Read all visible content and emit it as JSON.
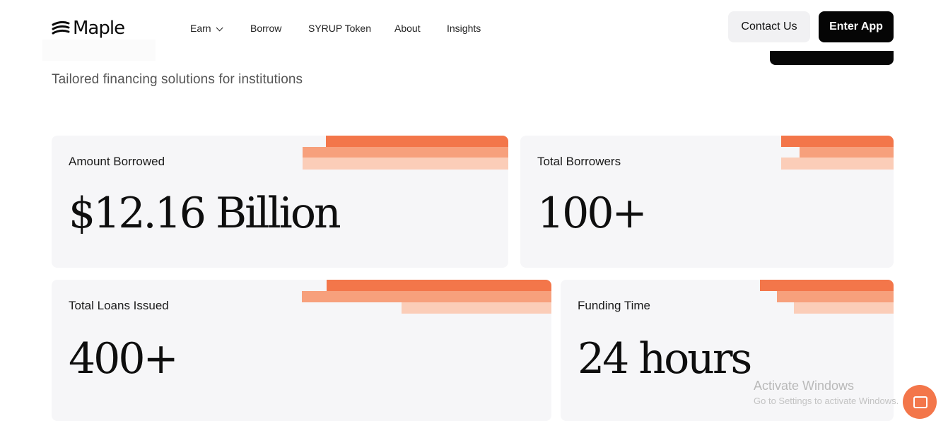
{
  "header": {
    "logo_text": "Maple",
    "nav": [
      {
        "label": "Earn",
        "has_dropdown": true
      },
      {
        "label": "Borrow"
      },
      {
        "label": "SYRUP Token"
      },
      {
        "label": "About"
      },
      {
        "label": "Insights"
      }
    ],
    "contact_label": "Contact Us",
    "enter_label": "Enter App"
  },
  "hero": {
    "subtitle": "Tailored financing solutions for institutions"
  },
  "stats": [
    {
      "label": "Amount Borrowed",
      "value": "$12.16 Billion"
    },
    {
      "label": "Total Borrowers",
      "value": "100+"
    },
    {
      "label": "Total Loans Issued",
      "value": "400+"
    },
    {
      "label": "Funding Time",
      "value": "24 hours"
    }
  ],
  "overlay": {
    "watermark_title": "Activate Windows",
    "watermark_sub": "Go to Settings to activate Windows."
  },
  "colors": {
    "accent": "#f3764a",
    "accent_mid": "#f7a07c",
    "accent_light": "#fbcdb8",
    "card_bg": "#f6f6f8",
    "button_dark": "#050505"
  },
  "icons": {
    "logo": "maple-logo-icon",
    "chat": "chat-icon",
    "dropdown": "chevron-down-icon"
  }
}
